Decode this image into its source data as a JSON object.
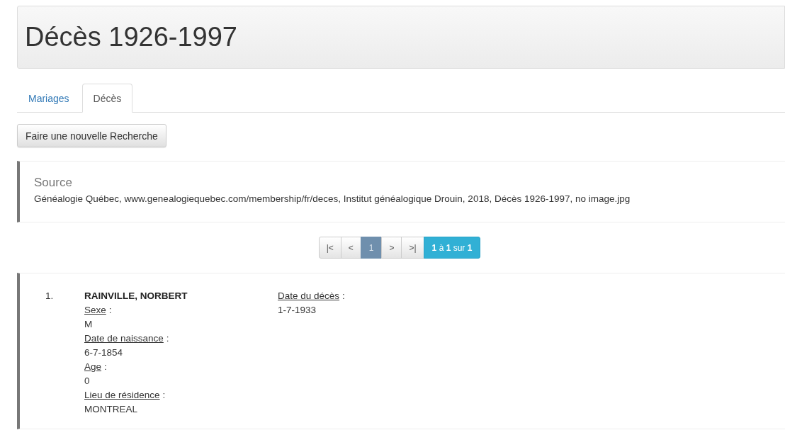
{
  "header": {
    "title": "Décès 1926-1997"
  },
  "tabs": [
    {
      "label": "Mariages",
      "selected": false
    },
    {
      "label": "Décès",
      "selected": true
    }
  ],
  "new_search_button": "Faire une nouvelle Recherche",
  "source": {
    "heading": "Source",
    "text": "Généalogie Québec, www.genealogiequebec.com/membership/fr/deces, Institut généalogique Drouin, 2018, Décès 1926-1997, no image.jpg"
  },
  "pagination": {
    "pages": [
      {
        "label": "|<",
        "selected": false
      },
      {
        "label": "<",
        "selected": false
      },
      {
        "label": "1",
        "selected": true
      },
      {
        "label": ">",
        "selected": false
      },
      {
        "label": ">|",
        "selected": false
      }
    ],
    "summary": "**1** à **1** sur **1**"
  },
  "results": [
    {
      "number": "1.",
      "name": "RAINVILLE, NORBERT",
      "fields": [
        {
          "label": "Sexe",
          "colon": ":",
          "value": "M"
        },
        {
          "label": "Date de naissance",
          "colon": ":",
          "value": "6-7-1854"
        },
        {
          "label": "Age",
          "colon": ":",
          "value": "0"
        },
        {
          "label": "Lieu de résidence",
          "colon": ":",
          "value": "MONTREAL"
        }
      ],
      "side_fields": [
        {
          "label": "Date du décès",
          "colon": ":",
          "value": "1-7-1933"
        }
      ]
    }
  ]
}
